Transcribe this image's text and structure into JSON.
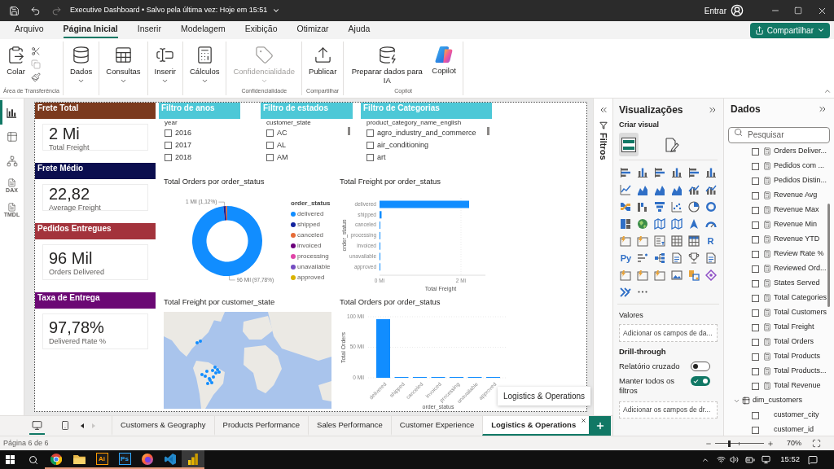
{
  "title_bar": {
    "title": "Executive Dashboard • Salvo pela última vez: Hoje em 15:51",
    "sign_in": "Entrar"
  },
  "ribbon": {
    "tabs": [
      {
        "label": "Arquivo",
        "selected": false
      },
      {
        "label": "Página Inicial",
        "selected": true
      },
      {
        "label": "Inserir",
        "selected": false
      },
      {
        "label": "Modelagem",
        "selected": false
      },
      {
        "label": "Exibição",
        "selected": false
      },
      {
        "label": "Otimizar",
        "selected": false
      },
      {
        "label": "Ajuda",
        "selected": false
      }
    ],
    "share_button": "Compartilhar",
    "groups": [
      {
        "label": "Área de Transferência",
        "commands": [
          {
            "kind": "paste",
            "label": "Colar",
            "dropdown": false,
            "disabled": false
          },
          {
            "kind": "clipboard_tools"
          }
        ]
      },
      {
        "commands": [
          {
            "kind": "data",
            "label": "Dados",
            "dropdown": true,
            "disabled": false
          }
        ]
      },
      {
        "commands": [
          {
            "kind": "queries",
            "label": "Consultas",
            "dropdown": true,
            "disabled": false
          }
        ]
      },
      {
        "commands": [
          {
            "kind": "insert",
            "label": "Inserir",
            "dropdown": true,
            "disabled": false
          }
        ]
      },
      {
        "commands": [
          {
            "kind": "calculations",
            "label": "Cálculos",
            "dropdown": true,
            "disabled": false
          }
        ]
      },
      {
        "label": "Confidencialidade",
        "commands": [
          {
            "kind": "sensitivity",
            "label": "Confidencialidade",
            "dropdown": true,
            "disabled": true
          }
        ]
      },
      {
        "label": "Compartilhar",
        "commands": [
          {
            "kind": "publish",
            "label": "Publicar",
            "dropdown": false,
            "disabled": false
          }
        ]
      },
      {
        "label": "Copilot",
        "commands": [
          {
            "kind": "prepare_ai",
            "label": "Preparar dados para IA",
            "dropdown": false,
            "disabled": false
          },
          {
            "kind": "copilot",
            "label": "Copilot",
            "dropdown": false,
            "disabled": false
          }
        ]
      }
    ]
  },
  "view_rail": [
    {
      "kind": "report",
      "selected": true
    },
    {
      "kind": "table",
      "selected": false
    },
    {
      "kind": "model",
      "selected": false
    },
    {
      "kind": "query",
      "badge": "DAX",
      "selected": false
    },
    {
      "kind": "query",
      "badge": "TMDL",
      "selected": false
    }
  ],
  "report_page": {
    "cards": [
      {
        "header": "Frete Total",
        "color": "#7b3a1e",
        "value": "2 Mi",
        "caption": "Total Freight"
      },
      {
        "header": "Frete Médio",
        "color": "#0b0e4f",
        "value": "22,82",
        "caption": "Average Freight"
      },
      {
        "header": "Pedidos Entregues",
        "color": "#a3333c",
        "value": "96 Mil",
        "caption": "Orders Delivered"
      },
      {
        "header": "Taxa de Entrega",
        "color": "#6b0874",
        "value": "97,78%",
        "caption": "Delivered Rate %"
      }
    ],
    "slicers": [
      {
        "header": "Filtro de anos",
        "field": "year",
        "scrollable": false,
        "items": [
          {
            "label": "2016",
            "checked": false
          },
          {
            "label": "2017",
            "checked": false
          },
          {
            "label": "2018",
            "checked": false
          }
        ]
      },
      {
        "header": "Filtro de estados",
        "field": "customer_state",
        "scrollable": true,
        "items": [
          {
            "label": "AC",
            "checked": false
          },
          {
            "label": "AL",
            "checked": false
          },
          {
            "label": "AM",
            "checked": false
          }
        ]
      },
      {
        "header": "Filtro de Categorias",
        "field": "product_category_name_english",
        "scrollable": true,
        "items": [
          {
            "label": "agro_industry_and_commerce",
            "checked": false
          },
          {
            "label": "air_conditioning",
            "checked": false
          },
          {
            "label": "art",
            "checked": false
          }
        ]
      }
    ],
    "order_share": {
      "chart_data": {
        "type": "donut",
        "title": "Total Orders por order_status",
        "legend": {
          "title": "order_status"
        },
        "categories": [
          "delivered",
          "shipped",
          "canceled",
          "invoiced",
          "processing",
          "unavailable",
          "approved"
        ],
        "colors": [
          "#118dff",
          "#12239e",
          "#e66c37",
          "#6b007b",
          "#e044a7",
          "#744ec2",
          "#d9b300"
        ],
        "values": [
          96.48,
          1.107,
          0.625,
          null,
          null,
          null,
          null
        ],
        "value_labels": [
          "96 Mil (97,78%)",
          "1 Mil (1,12%)",
          null,
          null,
          null,
          null,
          null
        ]
      }
    },
    "freight_by_status": {
      "chart_data": {
        "type": "bar",
        "orientation": "horizontal",
        "title": "Total Freight por order_status",
        "xlabel": "Total Freight",
        "ylabel": "order_status",
        "categories": [
          "delivered",
          "shipped",
          "canceled",
          "processing",
          "invoiced",
          "unavailable",
          "approved"
        ],
        "values": [
          2.2,
          0.05,
          0.02,
          0.02,
          0.02,
          0.02,
          0.02
        ],
        "xlim": [
          0,
          2.6
        ],
        "xticks": [
          {
            "value": 0,
            "label": "0 Mi"
          },
          {
            "value": 2,
            "label": "2 Mi"
          }
        ]
      }
    },
    "map_visual": {
      "title": "Total Freight por customer_state"
    },
    "orders_by_status": {
      "chart_data": {
        "type": "bar",
        "orientation": "vertical",
        "title": "Total Orders por order_status",
        "xlabel": "order_status",
        "ylabel": "Total Orders",
        "categories": [
          "delivered",
          "shipped",
          "canceled",
          "invoiced",
          "processing",
          "unavailable",
          "approved"
        ],
        "values": [
          96,
          1,
          1,
          0,
          0,
          1,
          0
        ],
        "ylim": [
          0,
          100
        ],
        "yticks": [
          {
            "value": 0,
            "label": "0 Mil"
          },
          {
            "value": 50,
            "label": "50 Mil"
          },
          {
            "value": 100,
            "label": "100 Mil"
          }
        ]
      }
    }
  },
  "filters_pane": {
    "title": "Filtros"
  },
  "visualizations_pane": {
    "title": "Visualizações",
    "section": "Criar visual",
    "modes": [
      {
        "kind": "build",
        "selected": true
      },
      {
        "kind": "format",
        "selected": false
      }
    ],
    "script_visuals": [
      "R",
      "Py"
    ],
    "values_well": {
      "label": "Valores",
      "placeholder": "Adicionar os campos de da..."
    },
    "drill_through": {
      "title": "Drill-through",
      "toggles": [
        {
          "label": "Relatório cruzado",
          "on": false
        },
        {
          "label": "Manter todos os filtros",
          "on": true
        }
      ],
      "placeholder": "Adicionar os campos de dr..."
    }
  },
  "data_pane": {
    "title": "Dados",
    "search_placeholder": "Pesquisar",
    "measures": [
      {
        "name": "Orders Deliver...",
        "checked": false
      },
      {
        "name": "Pedidos com ...",
        "checked": false
      },
      {
        "name": "Pedidos Distin...",
        "checked": false
      },
      {
        "name": "Revenue Avg",
        "checked": false
      },
      {
        "name": "Revenue Max",
        "checked": false
      },
      {
        "name": "Revenue Min",
        "checked": false
      },
      {
        "name": "Revenue YTD",
        "checked": false
      },
      {
        "name": "Review Rate %",
        "checked": false
      },
      {
        "name": "Reviewed Ord...",
        "checked": false
      },
      {
        "name": "States Served",
        "checked": false
      },
      {
        "name": "Total Categories",
        "checked": false
      },
      {
        "name": "Total Customers",
        "checked": false
      },
      {
        "name": "Total Freight",
        "checked": false
      },
      {
        "name": "Total Orders",
        "checked": false
      },
      {
        "name": "Total Products",
        "checked": false
      },
      {
        "name": "Total Products...",
        "checked": false
      },
      {
        "name": "Total Revenue",
        "checked": false
      }
    ],
    "tables": [
      {
        "name": "dim_customers",
        "expanded": true,
        "children": [
          {
            "name": "customer_city",
            "checked": false
          },
          {
            "name": "customer_id",
            "checked": false
          }
        ]
      }
    ]
  },
  "page_tabs": {
    "layouts": [
      {
        "kind": "desktop",
        "selected": true
      },
      {
        "kind": "mobile",
        "selected": false
      }
    ],
    "pager": [
      {
        "kind": "previous",
        "disabled": false
      },
      {
        "kind": "next",
        "disabled": true
      }
    ],
    "tabs": [
      {
        "label": "Customers & Geography",
        "selected": false
      },
      {
        "label": "Products Performance",
        "selected": false
      },
      {
        "label": "Sales Performance",
        "selected": false
      },
      {
        "label": "Customer Experience",
        "selected": false
      },
      {
        "label": "Logistics & Operations",
        "selected": true
      }
    ],
    "tooltip": "Logistics & Operations"
  },
  "status_bar": {
    "page": "Página 6 de 6",
    "zoom": {
      "level": 0.3,
      "reading": "70%"
    }
  },
  "taskbar": {
    "apps": [
      {
        "kind": "round_browser",
        "running": true,
        "selected": false
      },
      {
        "kind": "folder",
        "running": true,
        "selected": false
      },
      {
        "kind": "letters",
        "letters": "Ai",
        "color": "#ff9a00",
        "running": true,
        "selected": false
      },
      {
        "kind": "letters",
        "letters": "Ps",
        "color": "#31a8ff",
        "running": true,
        "selected": false
      },
      {
        "kind": "flame_browser",
        "running": true,
        "selected": false
      },
      {
        "kind": "editor",
        "running": true,
        "selected": false
      },
      {
        "kind": "report_tool",
        "running": true,
        "selected": true
      }
    ],
    "time": "15:52"
  }
}
